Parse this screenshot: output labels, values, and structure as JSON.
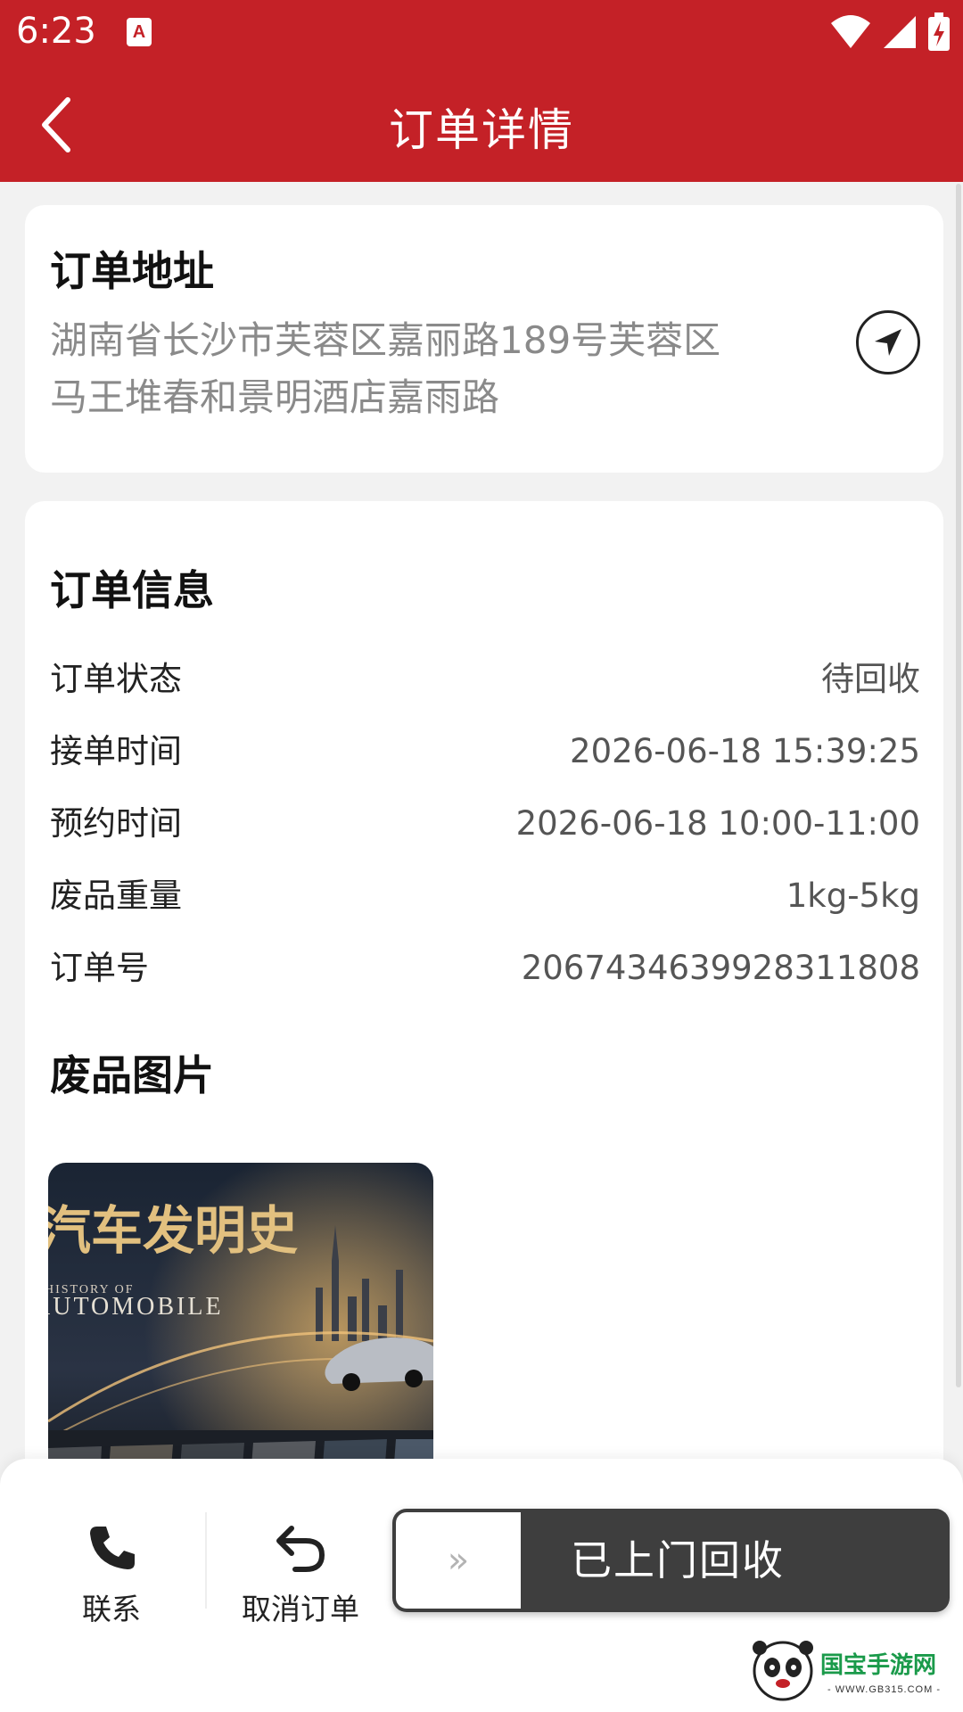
{
  "status_bar": {
    "time": "6:23",
    "notification_badge": "A",
    "icons": [
      "wifi-icon",
      "cell-signal-icon",
      "battery-charging-icon"
    ]
  },
  "app_bar": {
    "title": "订单详情",
    "back_icon": "chevron-left-icon"
  },
  "address_card": {
    "title": "订单地址",
    "address_line1": "湖南省长沙市芙蓉区嘉丽路189号芙蓉区",
    "address_line2": "马王堆春和景明酒店嘉雨路",
    "navigate_icon": "navigation-arrow-icon"
  },
  "order_info": {
    "title": "订单信息",
    "rows": [
      {
        "label": "订单状态",
        "value": "待回收"
      },
      {
        "label": "接单时间",
        "value": "2026-06-18 15:39:25"
      },
      {
        "label": "预约时间",
        "value": "2026-06-18 10:00-11:00"
      },
      {
        "label": "废品重量",
        "value": "1kg-5kg"
      },
      {
        "label": "订单号",
        "value": "2067434639928311808"
      }
    ]
  },
  "waste_images": {
    "title": "废品图片",
    "images": [
      {
        "title_cn": "汽车发明史",
        "title_en_line1": "HISTORY OF",
        "title_en_line2": "AUTOMOBILE"
      }
    ]
  },
  "bottom_bar": {
    "contact_label": "联系",
    "contact_icon": "phone-icon",
    "cancel_label": "取消订单",
    "cancel_icon": "undo-arrow-icon",
    "slide_handle": "»",
    "slide_label": "已上门回收"
  },
  "watermark": {
    "brand": "国宝手游网",
    "url": "WWW.GB315.COM"
  },
  "colors": {
    "brand_red": "#c42127",
    "slide_dark": "#3e3e3e",
    "muted_text": "#8a8a8a"
  }
}
